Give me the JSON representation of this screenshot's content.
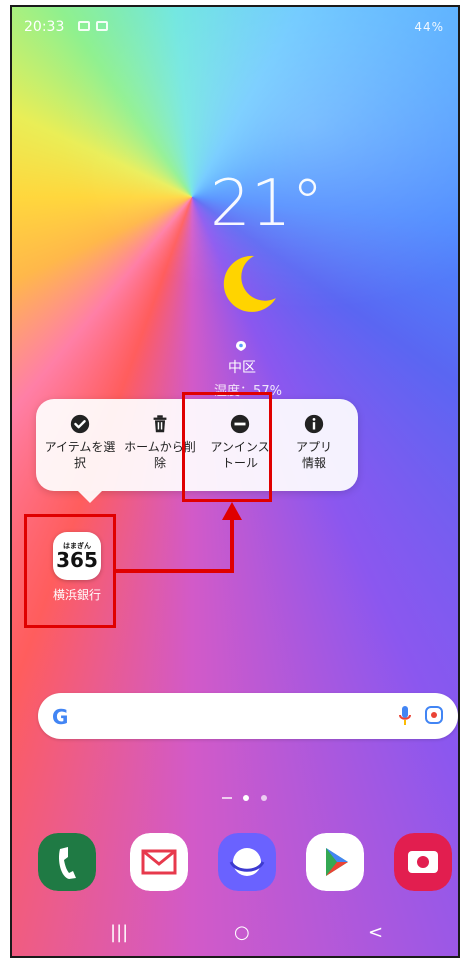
{
  "status_bar": {
    "time": "20:33",
    "right_text": "44%"
  },
  "weather": {
    "temperature": "21°",
    "location": "中区",
    "humidity": "湿度：57%"
  },
  "context_menu": {
    "items": [
      {
        "label": "アイテムを選\n択",
        "icon": "check-circle-icon"
      },
      {
        "label": "ホームから削\n除",
        "icon": "trash-icon"
      },
      {
        "label": "アンインス\nトール",
        "icon": "minus-circle-icon"
      },
      {
        "label": "アプリ\n情報",
        "icon": "info-icon"
      }
    ]
  },
  "app": {
    "badge_small": "はまぎん",
    "badge_big": "365",
    "name": "横浜銀行"
  },
  "search": {
    "logo": "G"
  },
  "dock": {
    "apps": [
      "phone-icon",
      "mail-icon",
      "internet-icon",
      "play-store-icon",
      "camera-icon"
    ]
  },
  "nav": {
    "recent": "|||",
    "home": "○",
    "back": "<"
  },
  "colors": {
    "highlight": "#e00000"
  }
}
